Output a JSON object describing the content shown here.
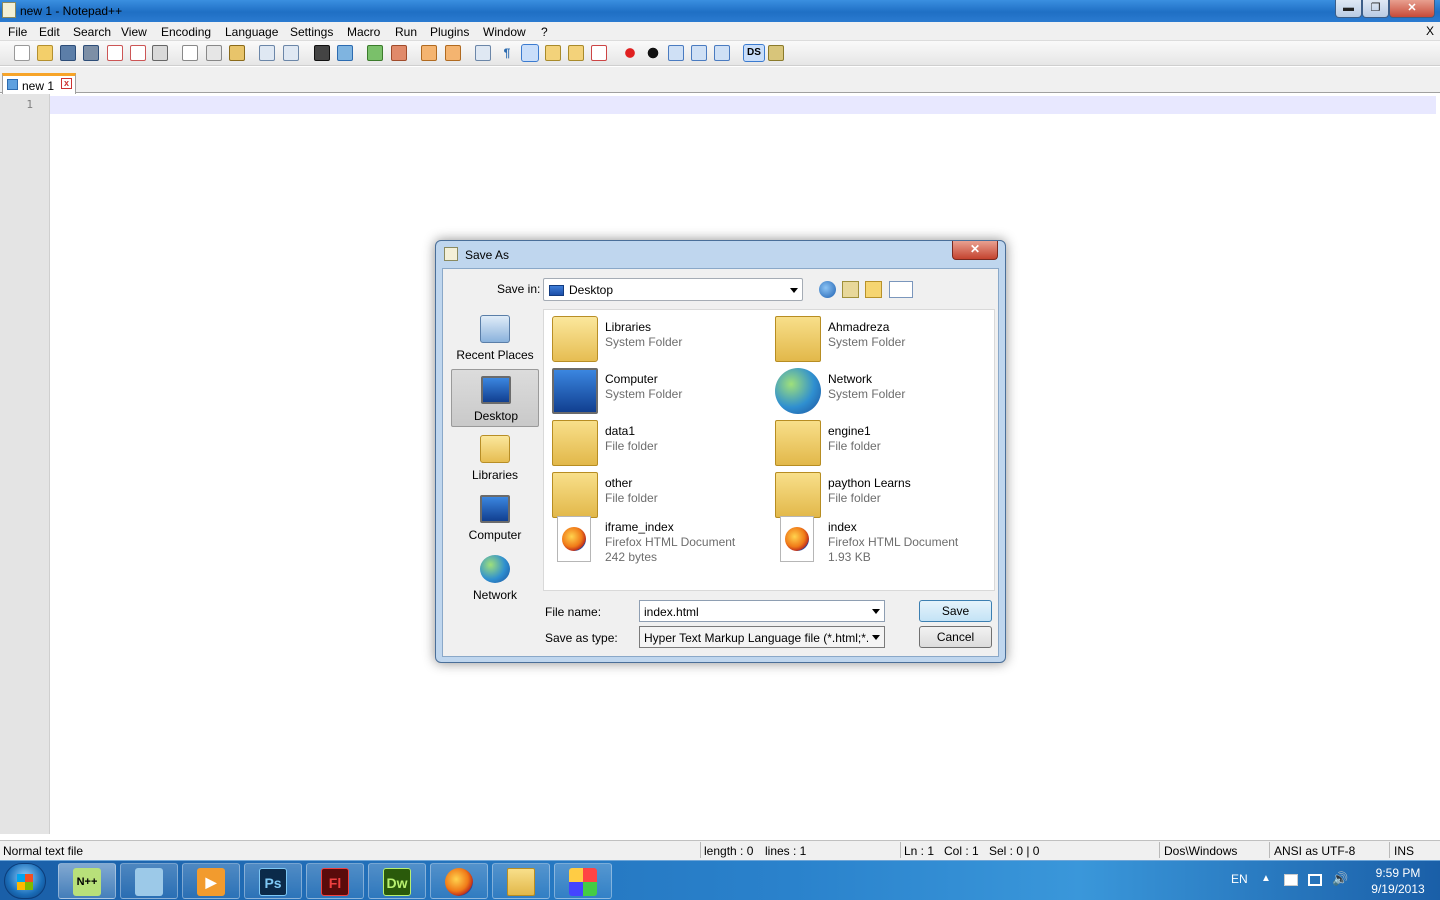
{
  "window": {
    "title": "new  1 - Notepad++",
    "controls": {
      "minimize": "▬",
      "maximize": "❐",
      "close": "✕"
    }
  },
  "menu": {
    "items": [
      "File",
      "Edit",
      "Search",
      "View",
      "Encoding",
      "Language",
      "Settings",
      "Macro",
      "Run",
      "Plugins",
      "Window",
      "?"
    ],
    "close_doc": "X"
  },
  "toolbar": {
    "icons": [
      "new-file-icon",
      "open-file-icon",
      "save-icon",
      "save-all-icon",
      "close-icon",
      "close-all-icon",
      "print-icon",
      "cut-icon",
      "copy-icon",
      "paste-icon",
      "undo-icon",
      "redo-icon",
      "find-icon",
      "replace-icon",
      "zoom-in-icon",
      "zoom-out-icon",
      "sync-vertical-icon",
      "sync-horizontal-icon",
      "word-wrap-icon",
      "show-all-chars-icon",
      "indent-guide-icon",
      "user-lang-icon",
      "doc-map-icon",
      "function-list-icon",
      "record-macro-icon",
      "stop-record-icon",
      "play-macro-icon",
      "run-macro-multiple-icon",
      "save-macro-icon",
      "ds-plugin-icon",
      "trim-icon"
    ],
    "ds_label": "DS"
  },
  "tabs": [
    {
      "label": "new  1",
      "active": true
    }
  ],
  "editor": {
    "line_numbers": [
      "1"
    ],
    "content": ""
  },
  "status": {
    "type": "Normal text file",
    "length": "length : 0",
    "lines": "lines : 1",
    "ln": "Ln : 1",
    "col": "Col : 1",
    "sel": "Sel : 0 | 0",
    "eol": "Dos\\Windows",
    "encoding": "ANSI as UTF-8",
    "mode": "INS"
  },
  "dialog": {
    "title": "Save As",
    "close": "✕",
    "save_in_label": "Save in:",
    "save_in_value": "Desktop",
    "places": [
      {
        "label": "Recent Places",
        "icon": "recent-places-icon",
        "selected": false
      },
      {
        "label": "Desktop",
        "icon": "desktop-icon",
        "selected": true
      },
      {
        "label": "Libraries",
        "icon": "libraries-icon",
        "selected": false
      },
      {
        "label": "Computer",
        "icon": "computer-icon",
        "selected": false
      },
      {
        "label": "Network",
        "icon": "network-icon",
        "selected": false
      }
    ],
    "files": [
      {
        "name": "Libraries",
        "type": "System Folder",
        "size": "",
        "icon": "libraries-folder-icon"
      },
      {
        "name": "Ahmadreza",
        "type": "System Folder",
        "size": "",
        "icon": "user-folder-icon"
      },
      {
        "name": "Computer",
        "type": "System Folder",
        "size": "",
        "icon": "computer-icon"
      },
      {
        "name": "Network",
        "type": "System Folder",
        "size": "",
        "icon": "network-icon"
      },
      {
        "name": "data1",
        "type": "File folder",
        "size": "",
        "icon": "folder-icon"
      },
      {
        "name": "engine1",
        "type": "File folder",
        "size": "",
        "icon": "folder-icon"
      },
      {
        "name": "other",
        "type": "File folder",
        "size": "",
        "icon": "folder-icon"
      },
      {
        "name": "paython Learns",
        "type": "File folder",
        "size": "",
        "icon": "folder-icon"
      },
      {
        "name": "iframe_index",
        "type": "Firefox HTML Document",
        "size": "242 bytes",
        "icon": "firefox-html-icon"
      },
      {
        "name": "index",
        "type": "Firefox HTML Document",
        "size": "1.93 KB",
        "icon": "firefox-html-icon"
      }
    ],
    "file_name_label": "File name:",
    "file_name_value": "index.html",
    "save_type_label": "Save as type:",
    "save_type_value": "Hyper Text Markup Language file (*.html;*.htm;*",
    "save_button": "Save",
    "cancel_button": "Cancel"
  },
  "taskbar": {
    "apps": [
      {
        "name": "notepad++",
        "label": "N++",
        "color": "#b8e07a",
        "active": true
      },
      {
        "name": "notepad",
        "label": "",
        "color": "#9cc9e8",
        "active": false
      },
      {
        "name": "media-player",
        "label": "▶",
        "color": "#f29b2e",
        "active": false
      },
      {
        "name": "photoshop",
        "label": "Ps",
        "color": "#0b2a4a",
        "active": false
      },
      {
        "name": "flash",
        "label": "Fl",
        "color": "#5a0b0b",
        "active": false
      },
      {
        "name": "dreamweaver",
        "label": "Dw",
        "color": "#2a5a0b",
        "active": false
      },
      {
        "name": "firefox",
        "label": "",
        "color": "#e8761a",
        "active": false
      },
      {
        "name": "explorer",
        "label": "",
        "color": "#f2cd6a",
        "active": false
      },
      {
        "name": "paint",
        "label": "",
        "color": "#f6f6f6",
        "active": false
      }
    ],
    "lang": "EN",
    "time": "9:59 PM",
    "date": "9/19/2013"
  }
}
